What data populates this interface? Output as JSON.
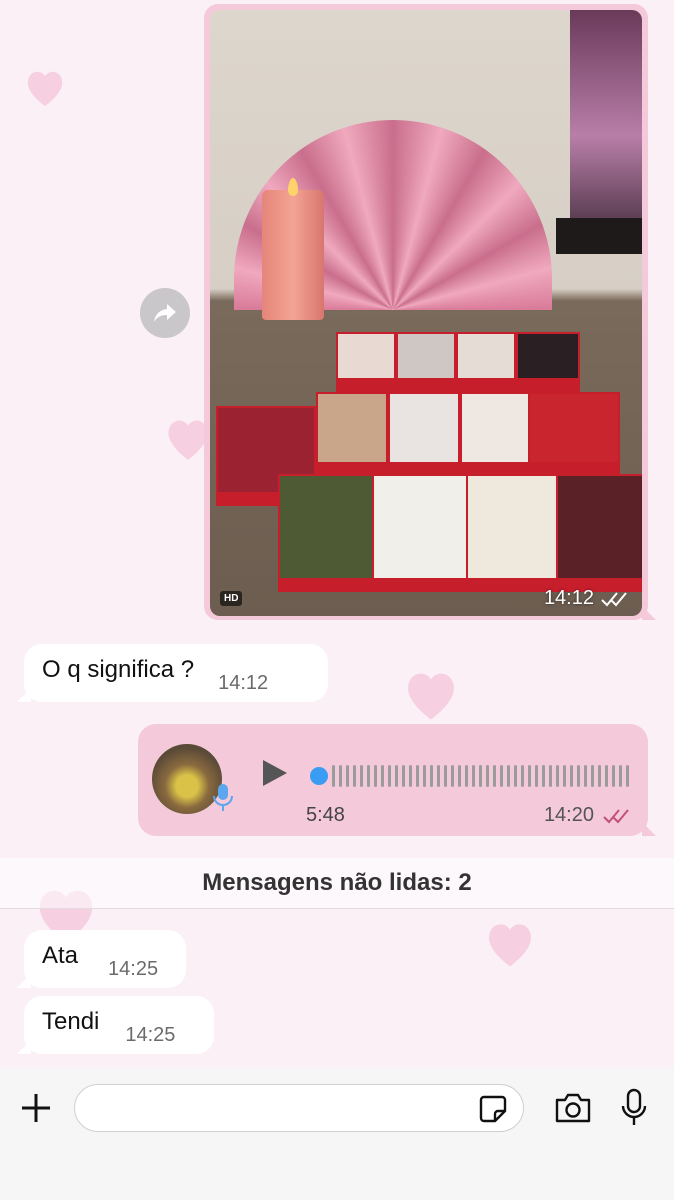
{
  "chat": {
    "image_message": {
      "hd_label": "HD",
      "time": "14:12",
      "status_icon": "double-check-icon"
    },
    "forward_icon": "forward-arrow-icon",
    "incoming_1": {
      "text": "O q significa ?",
      "time": "14:12"
    },
    "audio_message": {
      "duration": "5:48",
      "time": "14:20",
      "status_icon": "double-check-icon",
      "status_color": "#c2507a"
    },
    "unread_divider": "Mensagens não lidas: 2",
    "incoming_2": {
      "text": "Ata",
      "time": "14:25"
    },
    "incoming_3": {
      "text": "Tendi",
      "time": "14:25"
    }
  },
  "composer": {
    "input_value": "",
    "icons": [
      "plus-icon",
      "sticker-icon",
      "camera-icon",
      "microphone-icon"
    ]
  },
  "colors": {
    "background": "#fbf0f5",
    "outgoing_bubble": "#f4c9d9",
    "incoming_bubble": "#ffffff",
    "audio_progress": "#3b9cf3"
  }
}
